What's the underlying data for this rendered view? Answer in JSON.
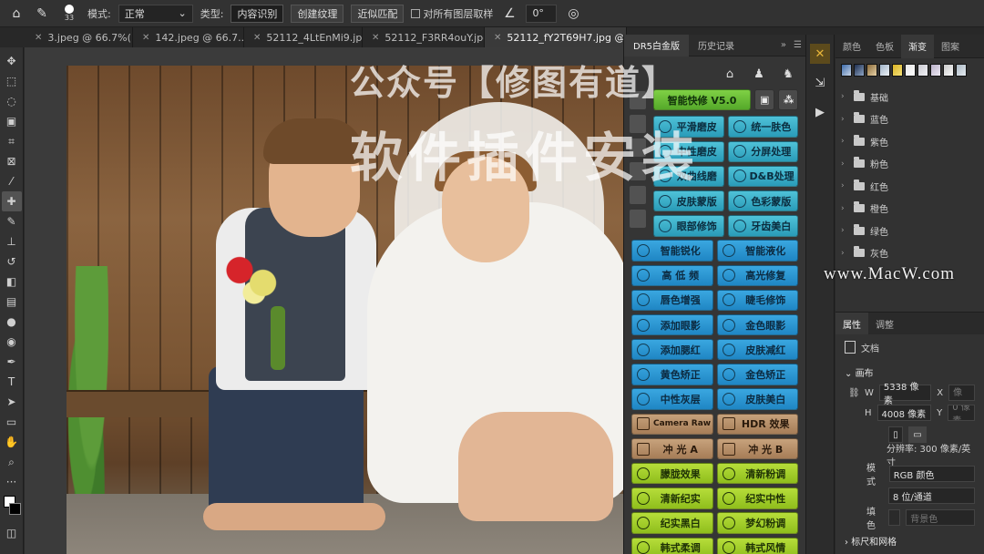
{
  "options_bar": {
    "brush_size": "33",
    "mode_label": "模式:",
    "mode_value": "正常",
    "type_label": "类型:",
    "type_buttons": [
      "内容识别",
      "创建纹理",
      "近似匹配"
    ],
    "sample_all_layers": "对所有图层取样",
    "angle_value": "0°"
  },
  "tabs": [
    {
      "label": "3.jpeg @ 66.7%(..."
    },
    {
      "label": "142.jpeg @ 66.7..."
    },
    {
      "label": "52112_4LtEnMi9.jpg"
    },
    {
      "label": "52112_F3RR4ouY.jpg"
    },
    {
      "label": "52112_fY2T69H7.jpg @ 33"
    }
  ],
  "watermark": {
    "line1": "公众号【修图有道】",
    "line2": "软件插件安装",
    "site": "www.MacW.com"
  },
  "dr5": {
    "tab_active": "DR5白金版",
    "tab_history": "历史记录",
    "buttons": [
      [
        "智能快修 V5.0",
        ""
      ],
      [
        "平滑磨皮",
        "统一肤色"
      ],
      [
        "中性磨皮",
        "分屏处理"
      ],
      [
        "双曲线磨",
        "D&B处理"
      ],
      [
        "皮肤蒙版",
        "色彩蒙版"
      ],
      [
        "眼部修饰",
        "牙齿美白"
      ],
      [
        "智能锐化",
        "智能液化"
      ],
      [
        "高 低 频",
        "高光修复"
      ],
      [
        "唇色增强",
        "睫毛修饰"
      ],
      [
        "添加眼影",
        "金色眼影"
      ],
      [
        "添加腮红",
        "皮肤减红"
      ],
      [
        "黄色矫正",
        "金色矫正"
      ],
      [
        "中性灰层",
        "皮肤美白"
      ],
      [
        "Camera Raw",
        "HDR 效果"
      ],
      [
        "冲 光 A",
        "冲 光 B"
      ],
      [
        "朦胧效果",
        "清新粉调"
      ],
      [
        "清新纪实",
        "纪实中性"
      ],
      [
        "纪实黑白",
        "梦幻粉调"
      ],
      [
        "韩式柔调",
        "韩式风情"
      ]
    ]
  },
  "right_panel": {
    "tabs": [
      "颜色",
      "色板",
      "渐变",
      "图案"
    ],
    "active_tab": "渐变",
    "folders": [
      "基础",
      "蓝色",
      "紫色",
      "粉色",
      "红色",
      "橙色",
      "绿色",
      "灰色"
    ]
  },
  "properties": {
    "tab_active": "属性",
    "tab_other": "调整",
    "doc_label": "文档",
    "canvas_label": "画布",
    "width_label": "W",
    "width_value": "5338 像素",
    "height_label": "H",
    "height_value": "4008 像素",
    "x_label": "X",
    "y_label": "Y",
    "x_value": "0 像素",
    "y_value": "0 像素",
    "resolution": "分辨率: 300 像素/英寸",
    "mode_label": "模式",
    "mode_value": "RGB 颜色",
    "depth_value": "8 位/通道",
    "fill_label": "填色",
    "fill_value": "背景色",
    "rulers_label": "标尺和网格"
  }
}
